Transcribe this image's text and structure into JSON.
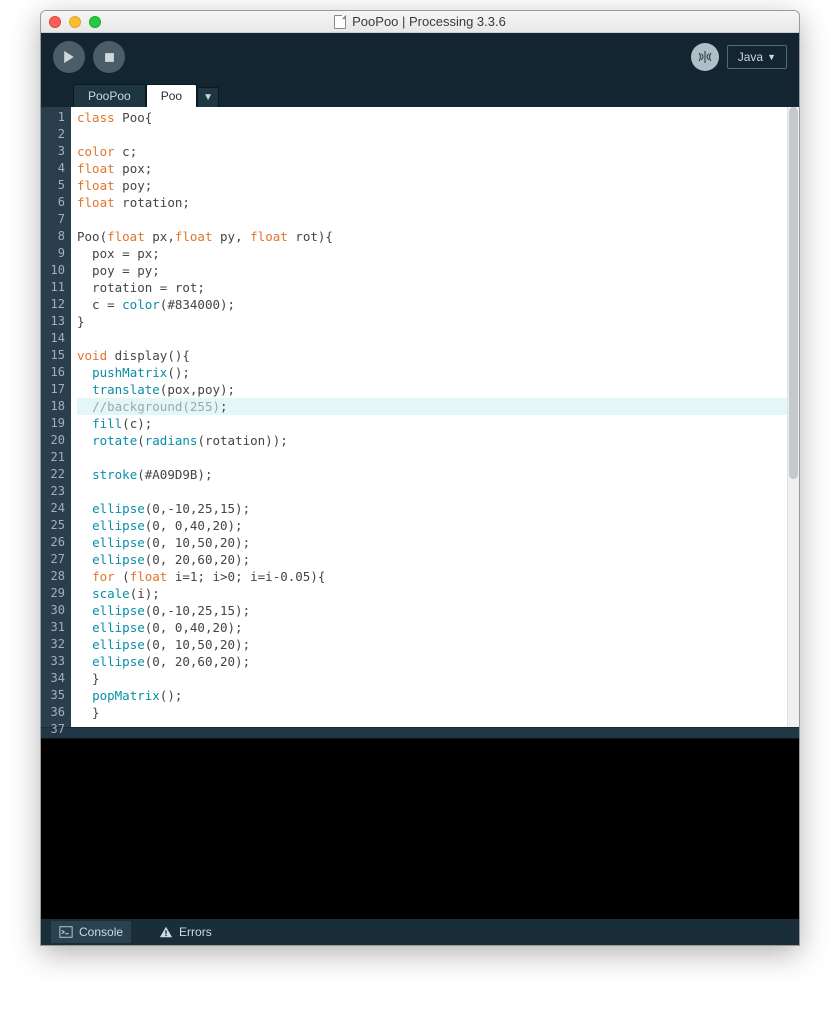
{
  "window": {
    "title": "PooPoo | Processing 3.3.6"
  },
  "toolbar": {
    "mode": "Java"
  },
  "tabs": [
    {
      "label": "PooPoo",
      "active": false
    },
    {
      "label": "Poo",
      "active": true
    }
  ],
  "bottombar": {
    "console": "Console",
    "errors": "Errors"
  },
  "code": {
    "lines": [
      {
        "n": 1,
        "tokens": [
          [
            "kw-type",
            "class"
          ],
          [
            "",
            " Poo{"
          ]
        ]
      },
      {
        "n": 2,
        "tokens": []
      },
      {
        "n": 3,
        "tokens": [
          [
            "kw-type",
            "color"
          ],
          [
            "",
            " c;"
          ]
        ]
      },
      {
        "n": 4,
        "tokens": [
          [
            "kw-type",
            "float"
          ],
          [
            "",
            " pox;"
          ]
        ]
      },
      {
        "n": 5,
        "tokens": [
          [
            "kw-type",
            "float"
          ],
          [
            "",
            " poy;"
          ]
        ]
      },
      {
        "n": 6,
        "tokens": [
          [
            "kw-type",
            "float"
          ],
          [
            "",
            " rotation;"
          ]
        ]
      },
      {
        "n": 7,
        "tokens": []
      },
      {
        "n": 8,
        "tokens": [
          [
            "",
            "Poo("
          ],
          [
            "kw-type",
            "float"
          ],
          [
            "",
            " px,"
          ],
          [
            "kw-type",
            "float"
          ],
          [
            "",
            " py, "
          ],
          [
            "kw-type",
            "float"
          ],
          [
            "",
            " rot){"
          ]
        ]
      },
      {
        "n": 9,
        "tokens": [
          [
            "",
            "  pox = px;"
          ]
        ]
      },
      {
        "n": 10,
        "tokens": [
          [
            "",
            "  poy = py;"
          ]
        ]
      },
      {
        "n": 11,
        "tokens": [
          [
            "",
            "  rotation = rot;"
          ]
        ]
      },
      {
        "n": 12,
        "tokens": [
          [
            "",
            "  c = "
          ],
          [
            "kw-fn",
            "color"
          ],
          [
            "",
            "(#834000);"
          ]
        ]
      },
      {
        "n": 13,
        "tokens": [
          [
            "",
            "}"
          ]
        ]
      },
      {
        "n": 14,
        "tokens": []
      },
      {
        "n": 15,
        "tokens": [
          [
            "kw-type",
            "void"
          ],
          [
            "",
            " display(){"
          ]
        ]
      },
      {
        "n": 16,
        "tokens": [
          [
            "",
            "  "
          ],
          [
            "kw-fn",
            "pushMatrix"
          ],
          [
            "",
            "();"
          ]
        ]
      },
      {
        "n": 17,
        "tokens": [
          [
            "",
            "  "
          ],
          [
            "kw-fn",
            "translate"
          ],
          [
            "",
            "(pox,poy);"
          ]
        ]
      },
      {
        "n": 18,
        "hl": true,
        "tokens": [
          [
            "",
            "  "
          ],
          [
            "cmt",
            "//background(255)"
          ],
          [
            "",
            ";"
          ]
        ]
      },
      {
        "n": 19,
        "tokens": [
          [
            "",
            "  "
          ],
          [
            "kw-fn",
            "fill"
          ],
          [
            "",
            "(c);"
          ]
        ]
      },
      {
        "n": 20,
        "tokens": [
          [
            "",
            "  "
          ],
          [
            "kw-fn",
            "rotate"
          ],
          [
            "",
            "("
          ],
          [
            "kw-fn",
            "radians"
          ],
          [
            "",
            "(rotation));"
          ]
        ]
      },
      {
        "n": 21,
        "tokens": []
      },
      {
        "n": 22,
        "tokens": [
          [
            "",
            "  "
          ],
          [
            "kw-fn",
            "stroke"
          ],
          [
            "",
            "(#A09D9B);"
          ]
        ]
      },
      {
        "n": 23,
        "tokens": []
      },
      {
        "n": 24,
        "tokens": [
          [
            "",
            "  "
          ],
          [
            "kw-fn",
            "ellipse"
          ],
          [
            "",
            "(0,-10,25,15);"
          ]
        ]
      },
      {
        "n": 25,
        "tokens": [
          [
            "",
            "  "
          ],
          [
            "kw-fn",
            "ellipse"
          ],
          [
            "",
            "(0, 0,40,20);"
          ]
        ]
      },
      {
        "n": 26,
        "tokens": [
          [
            "",
            "  "
          ],
          [
            "kw-fn",
            "ellipse"
          ],
          [
            "",
            "(0, 10,50,20);"
          ]
        ]
      },
      {
        "n": 27,
        "tokens": [
          [
            "",
            "  "
          ],
          [
            "kw-fn",
            "ellipse"
          ],
          [
            "",
            "(0, 20,60,20);"
          ]
        ]
      },
      {
        "n": 28,
        "tokens": [
          [
            "",
            "  "
          ],
          [
            "kw-type",
            "for"
          ],
          [
            "",
            " ("
          ],
          [
            "kw-type",
            "float"
          ],
          [
            "",
            " i=1; i>0; i=i-0.05){"
          ]
        ]
      },
      {
        "n": 29,
        "tokens": [
          [
            "",
            "  "
          ],
          [
            "kw-fn",
            "scale"
          ],
          [
            "",
            "(i);"
          ]
        ]
      },
      {
        "n": 30,
        "tokens": [
          [
            "",
            "  "
          ],
          [
            "kw-fn",
            "ellipse"
          ],
          [
            "",
            "(0,-10,25,15);"
          ]
        ]
      },
      {
        "n": 31,
        "tokens": [
          [
            "",
            "  "
          ],
          [
            "kw-fn",
            "ellipse"
          ],
          [
            "",
            "(0, 0,40,20);"
          ]
        ]
      },
      {
        "n": 32,
        "tokens": [
          [
            "",
            "  "
          ],
          [
            "kw-fn",
            "ellipse"
          ],
          [
            "",
            "(0, 10,50,20);"
          ]
        ]
      },
      {
        "n": 33,
        "tokens": [
          [
            "",
            "  "
          ],
          [
            "kw-fn",
            "ellipse"
          ],
          [
            "",
            "(0, 20,60,20);"
          ]
        ]
      },
      {
        "n": 34,
        "tokens": [
          [
            "",
            "  }"
          ]
        ]
      },
      {
        "n": 35,
        "tokens": [
          [
            "",
            "  "
          ],
          [
            "kw-fn",
            "popMatrix"
          ],
          [
            "",
            "();"
          ]
        ]
      },
      {
        "n": 36,
        "tokens": [
          [
            "",
            "  }"
          ]
        ]
      },
      {
        "n": 37,
        "tokens": []
      }
    ]
  }
}
